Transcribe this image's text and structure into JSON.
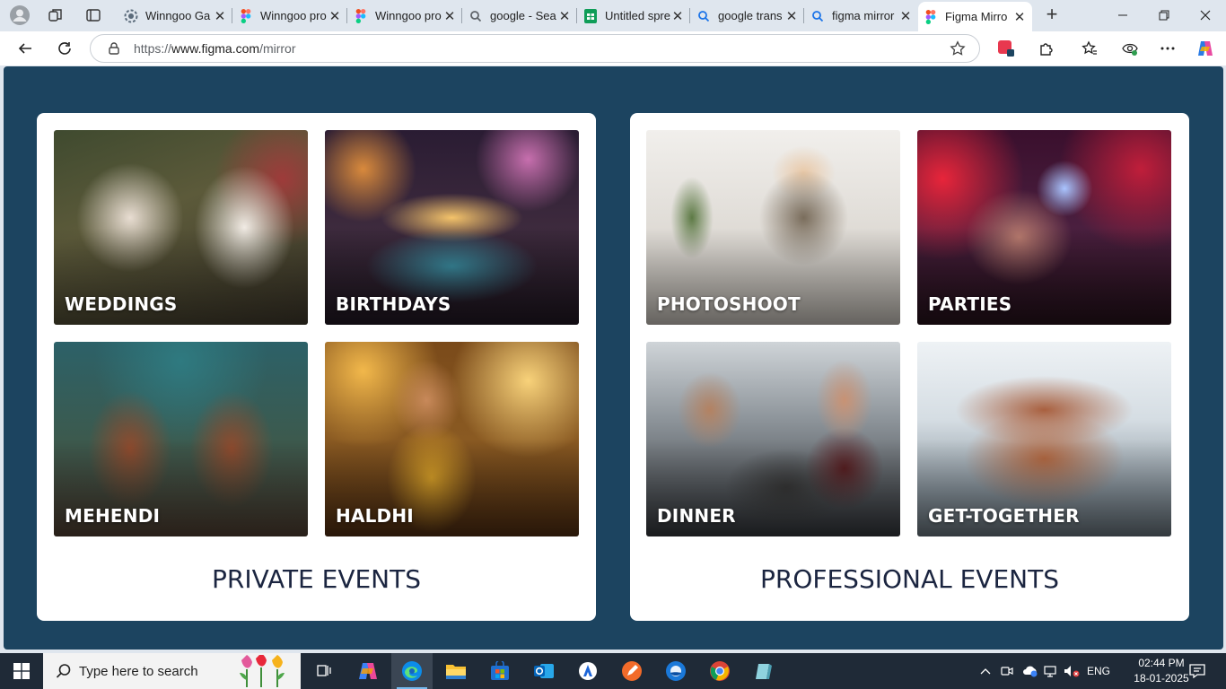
{
  "browser": {
    "tabs": [
      {
        "title": "Winngoo Ga",
        "favicon": "gear-favicon"
      },
      {
        "title": "Winngoo pro",
        "favicon": "figma-favicon"
      },
      {
        "title": "Winngoo pro",
        "favicon": "figma-favicon"
      },
      {
        "title": "google - Sea",
        "favicon": "search-favicon"
      },
      {
        "title": "Untitled spre",
        "favicon": "sheets-favicon"
      },
      {
        "title": "google trans",
        "favicon": "search-favicon"
      },
      {
        "title": "figma mirror",
        "favicon": "search-favicon"
      },
      {
        "title": "Figma Mirro",
        "favicon": "figma-favicon",
        "active": true
      }
    ],
    "address": {
      "scheme": "https://",
      "host": "www.figma.com",
      "path": "/mirror"
    }
  },
  "page": {
    "private": {
      "title": "PRIVATE EVENTS",
      "cards": [
        {
          "label": "WEDDINGS"
        },
        {
          "label": "BIRTHDAYS"
        },
        {
          "label": "MEHENDI"
        },
        {
          "label": "HALDHI"
        }
      ]
    },
    "professional": {
      "title": "PROFESSIONAL EVENTS",
      "cards": [
        {
          "label": "PHOTOSHOOT"
        },
        {
          "label": "PARTIES"
        },
        {
          "label": "DINNER"
        },
        {
          "label": "GET-TOGETHER"
        }
      ]
    },
    "colors": {
      "background": "#1c4460",
      "panel": "#ffffff",
      "title_text": "#1b2540"
    }
  },
  "taskbar": {
    "search_placeholder": "Type here to search",
    "language": "ENG",
    "time": "02:44 PM",
    "date": "18-01-2025",
    "apps": [
      "copilot-icon",
      "edge-icon",
      "file-explorer-icon",
      "store-icon",
      "outlook-icon",
      "app-icon",
      "pencil-app-icon",
      "browser-icon",
      "chrome-icon",
      "notepad-icon"
    ]
  }
}
